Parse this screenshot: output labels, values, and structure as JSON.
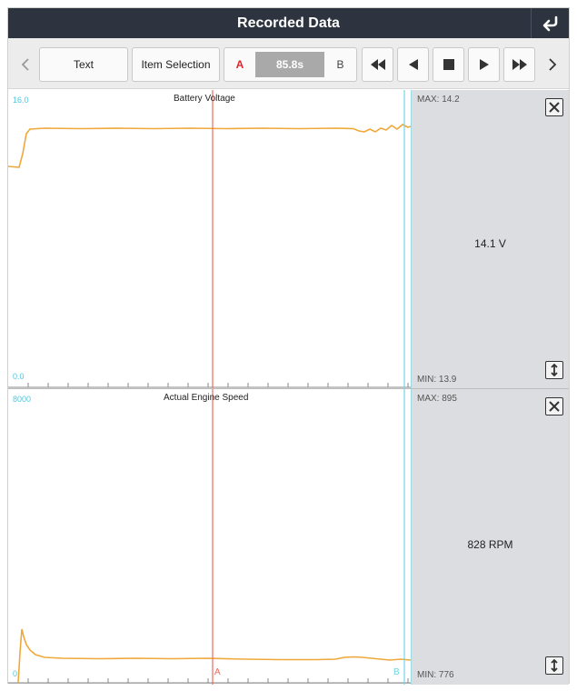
{
  "header": {
    "title": "Recorded Data",
    "back_icon": "return-arrow-icon"
  },
  "toolbar": {
    "prev_icon": "chevron-left-icon",
    "text_label": "Text",
    "item_selection_label": "Item Selection",
    "marker_a": "A",
    "time_value": "85.8s",
    "marker_b": "B",
    "fast_rewind_icon": "fast-rewind-icon",
    "step_back_icon": "step-back-icon",
    "stop_icon": "stop-icon",
    "play_icon": "play-icon",
    "fast_forward_icon": "fast-forward-icon",
    "next_icon": "chevron-right-icon"
  },
  "panels": [
    {
      "title": "Battery Voltage",
      "y_top": "16.0",
      "y_bottom": "0.0",
      "max_label": "MAX: 14.2",
      "min_label": "MIN: 13.9",
      "current_value": "14.1 V"
    },
    {
      "title": "Actual Engine Speed",
      "y_top": "8000",
      "y_bottom": "0",
      "max_label": "MAX: 895",
      "min_label": "MIN: 776",
      "current_value": "828 RPM",
      "cursor_a_label": "A",
      "cursor_b_label": "B"
    }
  ],
  "colors": {
    "trace": "#f0a83a",
    "cursor_a": "#f06a5a",
    "cursor_b": "#6fd6e6",
    "axis_label": "#4cc9e0",
    "titlebar": "#2d3440"
  }
}
